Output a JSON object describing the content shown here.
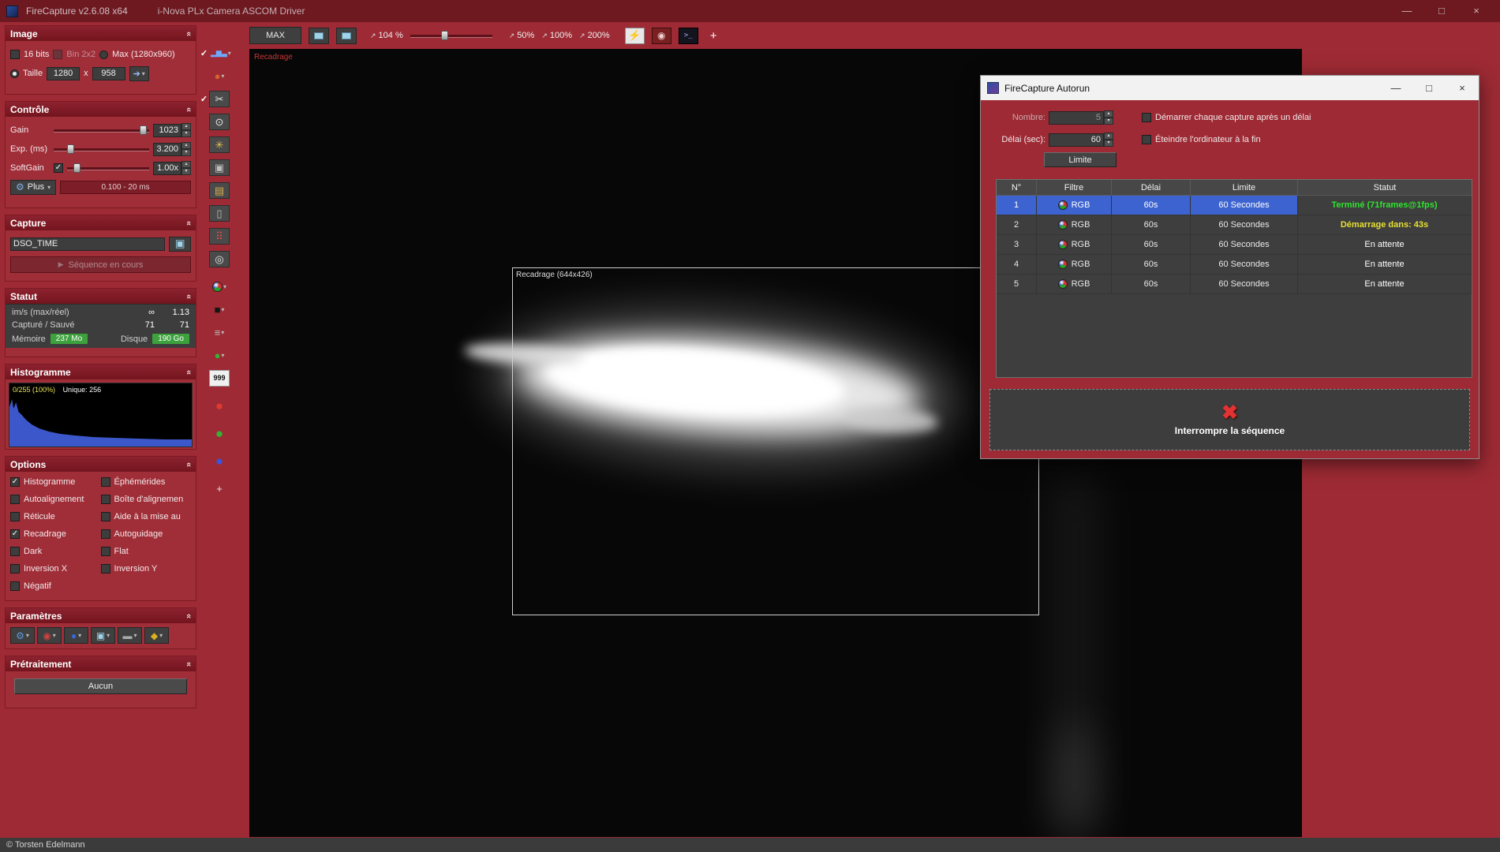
{
  "window": {
    "title": "FireCapture v2.6.08  x64",
    "subtitle": "i-Nova PLx Camera ASCOM Driver",
    "minimize": "—",
    "maximize": "□",
    "close": "×"
  },
  "ui": {
    "caret": "▾",
    "up": "▴",
    "down": "▾",
    "collapse": "«"
  },
  "toolbar_top": {
    "max_label": "MAX",
    "zoom_arrow": "↗",
    "zoom_value": "104 %",
    "zoom_50": "50%",
    "zoom_100": "100%",
    "zoom_200": "200%",
    "runner_glyph": "⚡",
    "camera_glyph": "◉",
    "console_glyph": ">_",
    "plus_label": "+"
  },
  "left_toolbar": {
    "items": [
      {
        "name": "histogram",
        "check": "✓",
        "glyph": "▂▆▃",
        "caret": "▾"
      },
      {
        "name": "color-balance",
        "check": "",
        "glyph": "●",
        "caret": "▾"
      },
      {
        "name": "scissors",
        "check": "✓",
        "glyph": "✂",
        "caret": ""
      },
      {
        "name": "magnifier",
        "check": "",
        "glyph": "⊙",
        "caret": ""
      },
      {
        "name": "sparkle",
        "check": "",
        "glyph": "✳",
        "caret": ""
      },
      {
        "name": "camera",
        "check": "",
        "glyph": "▣",
        "caret": ""
      },
      {
        "name": "folder",
        "check": "",
        "glyph": "▤",
        "caret": ""
      },
      {
        "name": "trash",
        "check": "",
        "glyph": "▯",
        "caret": ""
      },
      {
        "name": "hot-pixel",
        "check": "",
        "glyph": "⠿",
        "caret": ""
      },
      {
        "name": "target",
        "check": "",
        "glyph": "◎",
        "caret": ""
      },
      {
        "name": "rgb-filter",
        "check": "",
        "glyph": "",
        "caret": "▾"
      },
      {
        "name": "dark-frame",
        "check": "",
        "glyph": "■",
        "caret": "▾"
      },
      {
        "name": "flat-frame",
        "check": "",
        "glyph": "≡",
        "caret": "▾"
      },
      {
        "name": "green-filter",
        "check": "",
        "glyph": "●",
        "caret": "▾"
      },
      {
        "name": "frame-counter",
        "check": "",
        "glyph": "999",
        "caret": ""
      },
      {
        "name": "red-indicator",
        "check": "",
        "glyph": "●",
        "caret": ""
      },
      {
        "name": "green-indicator",
        "check": "",
        "glyph": "●",
        "caret": ""
      },
      {
        "name": "blue-indicator",
        "check": "",
        "glyph": "●",
        "caret": ""
      },
      {
        "name": "add",
        "check": "",
        "glyph": "+",
        "caret": ""
      }
    ]
  },
  "panels": {
    "image": {
      "header": "Image",
      "bits_label": "16 bits",
      "bits_mark": "",
      "bin_label": "Bin 2x2",
      "bin_mark": "",
      "max_label": "Max (1280x960)",
      "taille_label": "Taille",
      "width_value": "1280",
      "x_sep": "x",
      "height_value": "958",
      "apply_glyph": "➔"
    },
    "controle": {
      "header": "Contrôle",
      "gain_label": "Gain",
      "gain_value": "1023",
      "exp_label": "Exp. (ms)",
      "exp_value": "3.200",
      "softgain_label": "SoftGain",
      "softgain_mark": "✓",
      "softgain_value": "1.00x",
      "plus_glyph": "⚙",
      "plus_label": "Plus",
      "range_label": "0.100 - 20 ms"
    },
    "capture": {
      "header": "Capture",
      "filename_value": "DSO_TIME",
      "camera_glyph": "▣",
      "sequence_glyph": "▶",
      "sequence_label": "Séquence en cours"
    },
    "statut": {
      "header": "Statut",
      "rows": [
        {
          "label": "im/s (max/réel)",
          "v1": "∞",
          "v2": "1.13"
        },
        {
          "label": "Capturé / Sauvé",
          "v1": "71",
          "v2": "71"
        }
      ],
      "memoire_label": "Mémoire",
      "memoire_value": "237 Mo",
      "disque_label": "Disque",
      "disque_value": "190 Go"
    },
    "histogramme": {
      "header": "Histogramme",
      "overlay_left": "0/255 (100%)",
      "overlay_right": "Unique: 256"
    },
    "options": {
      "header": "Options",
      "left": [
        {
          "label": "Histogramme",
          "mark": "✓"
        },
        {
          "label": "Autoalignement",
          "mark": ""
        },
        {
          "label": "Réticule",
          "mark": ""
        },
        {
          "label": "Recadrage",
          "mark": "✓"
        },
        {
          "label": "Dark",
          "mark": ""
        },
        {
          "label": "Inversion X",
          "mark": ""
        },
        {
          "label": "Négatif",
          "mark": ""
        }
      ],
      "right": [
        {
          "label": "Éphémérides",
          "mark": ""
        },
        {
          "label": "Boîte d'alignemen",
          "mark": ""
        },
        {
          "label": "Aide à la mise au",
          "mark": ""
        },
        {
          "label": "Autoguidage",
          "mark": ""
        },
        {
          "label": "Flat",
          "mark": ""
        },
        {
          "label": "Inversion Y",
          "mark": ""
        }
      ]
    },
    "parametres": {
      "header": "Paramètres",
      "icons": [
        {
          "name": "gear",
          "glyph": "⚙"
        },
        {
          "name": "color-wheel",
          "glyph": "◉"
        },
        {
          "name": "blue-ball",
          "glyph": "●"
        },
        {
          "name": "display",
          "glyph": "▣"
        },
        {
          "name": "gray-bar",
          "glyph": "▬"
        },
        {
          "name": "gold-diamond",
          "glyph": "◆"
        }
      ]
    },
    "pretraitement": {
      "header": "Prétraitement",
      "button_label": "Aucun"
    }
  },
  "image_area": {
    "recadrage_label": "Recadrage",
    "crop_label": "Recadrage (644x426)"
  },
  "dialog": {
    "title": "FireCapture Autorun",
    "minimize": "—",
    "maximize": "□",
    "close": "×",
    "nombre_label": "Nombre:",
    "nombre_value": "5",
    "delai_label": "Délai (sec):",
    "delai_value": "60",
    "check1": "Démarrer chaque capture après un délai",
    "check1_mark": "",
    "check2": "Éteindre l'ordinateur à la fin",
    "check2_mark": "",
    "limite_button": "Limite",
    "headers": [
      "N°",
      "Filtre",
      "Délai",
      "Limite",
      "Statut"
    ],
    "rows": [
      {
        "num": "1",
        "filtre": "RGB",
        "delai": "60s",
        "limite": "60 Secondes",
        "statut": "Terminé  (71frames@1fps)"
      },
      {
        "num": "2",
        "filtre": "RGB",
        "delai": "60s",
        "limite": "60 Secondes",
        "statut": "Démarrage dans: 43s"
      },
      {
        "num": "3",
        "filtre": "RGB",
        "delai": "60s",
        "limite": "60 Secondes",
        "statut": "En attente"
      },
      {
        "num": "4",
        "filtre": "RGB",
        "delai": "60s",
        "limite": "60 Secondes",
        "statut": "En attente"
      },
      {
        "num": "5",
        "filtre": "RGB",
        "delai": "60s",
        "limite": "60 Secondes",
        "statut": "En attente"
      }
    ],
    "interrupt_icon": "✖",
    "interrupt_label": "Interrompre la séquence"
  },
  "status_bar": {
    "copyright": "© Torsten Edelmann"
  }
}
